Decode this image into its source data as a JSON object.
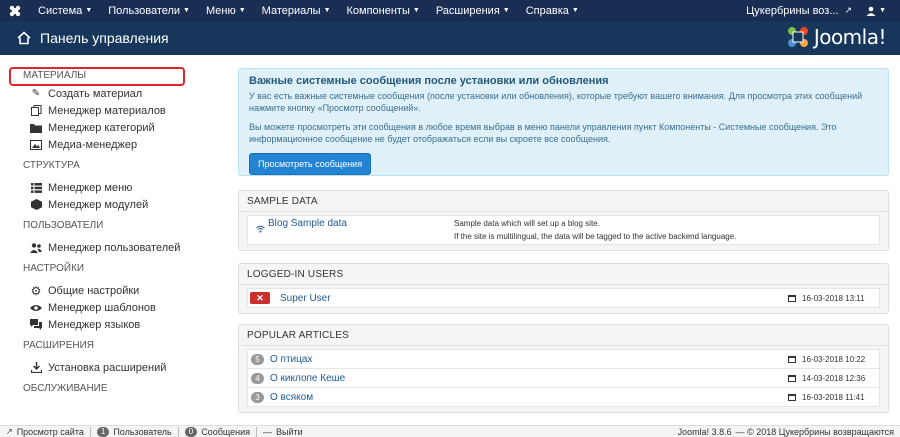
{
  "topbar": {
    "menu": [
      {
        "label": "Система"
      },
      {
        "label": "Пользователи"
      },
      {
        "label": "Меню"
      },
      {
        "label": "Материалы"
      },
      {
        "label": "Компоненты"
      },
      {
        "label": "Расширения"
      },
      {
        "label": "Справка"
      }
    ],
    "site_name": "Цукербрины воз...",
    "user_icon": "user-icon"
  },
  "header": {
    "title": "Панель управления",
    "brand": "Joomla!"
  },
  "sidebar": {
    "sections": [
      {
        "title": "МАТЕРИАЛЫ",
        "items": [
          {
            "label": "Создать материал",
            "icon": "pencil-icon"
          },
          {
            "label": "Менеджер материалов",
            "icon": "stack-icon"
          },
          {
            "label": "Менеджер категорий",
            "icon": "folder-icon"
          },
          {
            "label": "Медиа-менеджер",
            "icon": "image-icon"
          }
        ]
      },
      {
        "title": "СТРУКТУРА",
        "items": [
          {
            "label": "Менеджер меню",
            "icon": "list-icon"
          },
          {
            "label": "Менеджер модулей",
            "icon": "cube-icon"
          }
        ]
      },
      {
        "title": "ПОЛЬЗОВАТЕЛИ",
        "items": [
          {
            "label": "Менеджер пользователей",
            "icon": "users-icon"
          }
        ]
      },
      {
        "title": "НАСТРОЙКИ",
        "items": [
          {
            "label": "Общие настройки",
            "icon": "cog-icon"
          },
          {
            "label": "Менеджер шаблонов",
            "icon": "eye-icon"
          },
          {
            "label": "Менеджер языков",
            "icon": "comments-icon"
          }
        ]
      },
      {
        "title": "РАСШИРЕНИЯ",
        "items": [
          {
            "label": "Установка расширений",
            "icon": "download-icon"
          }
        ]
      },
      {
        "title": "ОБСЛУЖИВАНИЕ",
        "items": []
      }
    ]
  },
  "alert": {
    "title": "Важные системные сообщения после установки или обновления",
    "text1": "У вас есть важные системные сообщения (после установки или обновления), которые требуют вашего внимания. Для просмотра этих сообщений нажмите кнопку «Просмотр сообщений».",
    "text2": "Вы можете просмотреть эти сообщения в любое время выбрав в меню панели управления пункт Компоненты - Системные сообщения. Это информационное сообщение не будет отображаться если вы скроете все сообщения.",
    "button": "Просмотреть сообщения"
  },
  "sample_data": {
    "title": "SAMPLE DATA",
    "item_label": "Blog Sample data",
    "desc1": "Sample data which will set up a blog site.",
    "desc2": "If the site is multilingual, the data will be tagged to the active backend language."
  },
  "logged_in": {
    "title": "LOGGED-IN USERS",
    "users": [
      {
        "name": "Super User",
        "date": "16-03-2018 13:11"
      }
    ]
  },
  "popular": {
    "title": "POPULAR ARTICLES",
    "articles": [
      {
        "hits": "5",
        "title": "О птицах",
        "date": "16-03-2018 10:22"
      },
      {
        "hits": "4",
        "title": "О киклопе Кеше",
        "date": "14-03-2018 12:36"
      },
      {
        "hits": "3",
        "title": "О всяком",
        "date": "16-03-2018 11:41"
      }
    ]
  },
  "statusbar": {
    "view_site": "Просмотр сайта",
    "users_count": "1",
    "users_label": "Пользователь",
    "messages_count": "0",
    "messages_label": "Сообщения",
    "logout": "Выйти",
    "version": "Joomla! 3.8.6",
    "copyright": "— © 2018 Цукербрины возвращаются"
  },
  "colors": {
    "topbar": "#1a2e54",
    "header": "#17365b",
    "link": "#1f5b98",
    "highlight": "#e0252b",
    "primary_button": "#2384d3"
  }
}
